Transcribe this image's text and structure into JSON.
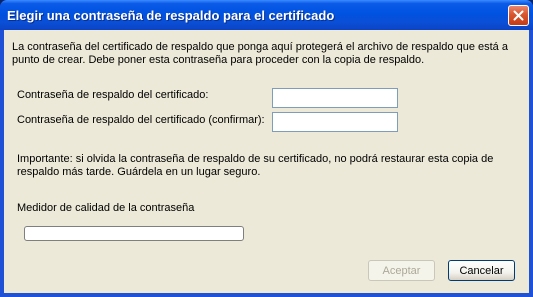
{
  "window": {
    "title": "Elegir una contraseña de respaldo para el certificado"
  },
  "dialog": {
    "intro_line1": "La contraseña del certificado de respaldo que ponga aquí protegerá el archivo de respaldo que está a",
    "intro_line2": "punto de crear. Debe poner esta contraseña para proceder con la copia de respaldo.",
    "password_label": "Contraseña de respaldo del certificado:",
    "password_value": "",
    "confirm_label": "Contraseña de respaldo del certificado (confirmar):",
    "confirm_value": "",
    "warning_line1": "Importante: si olvida la contraseña de respaldo de su certificado, no podrá restaurar esta copia de",
    "warning_line2": "respaldo más tarde. Guárdela en un lugar seguro.",
    "meter_label": "Medidor de calidad de la contraseña",
    "meter_value": 0
  },
  "buttons": {
    "accept_label": "Aceptar",
    "accept_enabled": false,
    "cancel_label": "Cancelar"
  },
  "icons": {
    "close": "close-icon"
  },
  "colors": {
    "titlebar": "#0052e0",
    "client_bg": "#ece9d8",
    "close_button": "#d8562f",
    "input_border": "#7f9db9"
  }
}
